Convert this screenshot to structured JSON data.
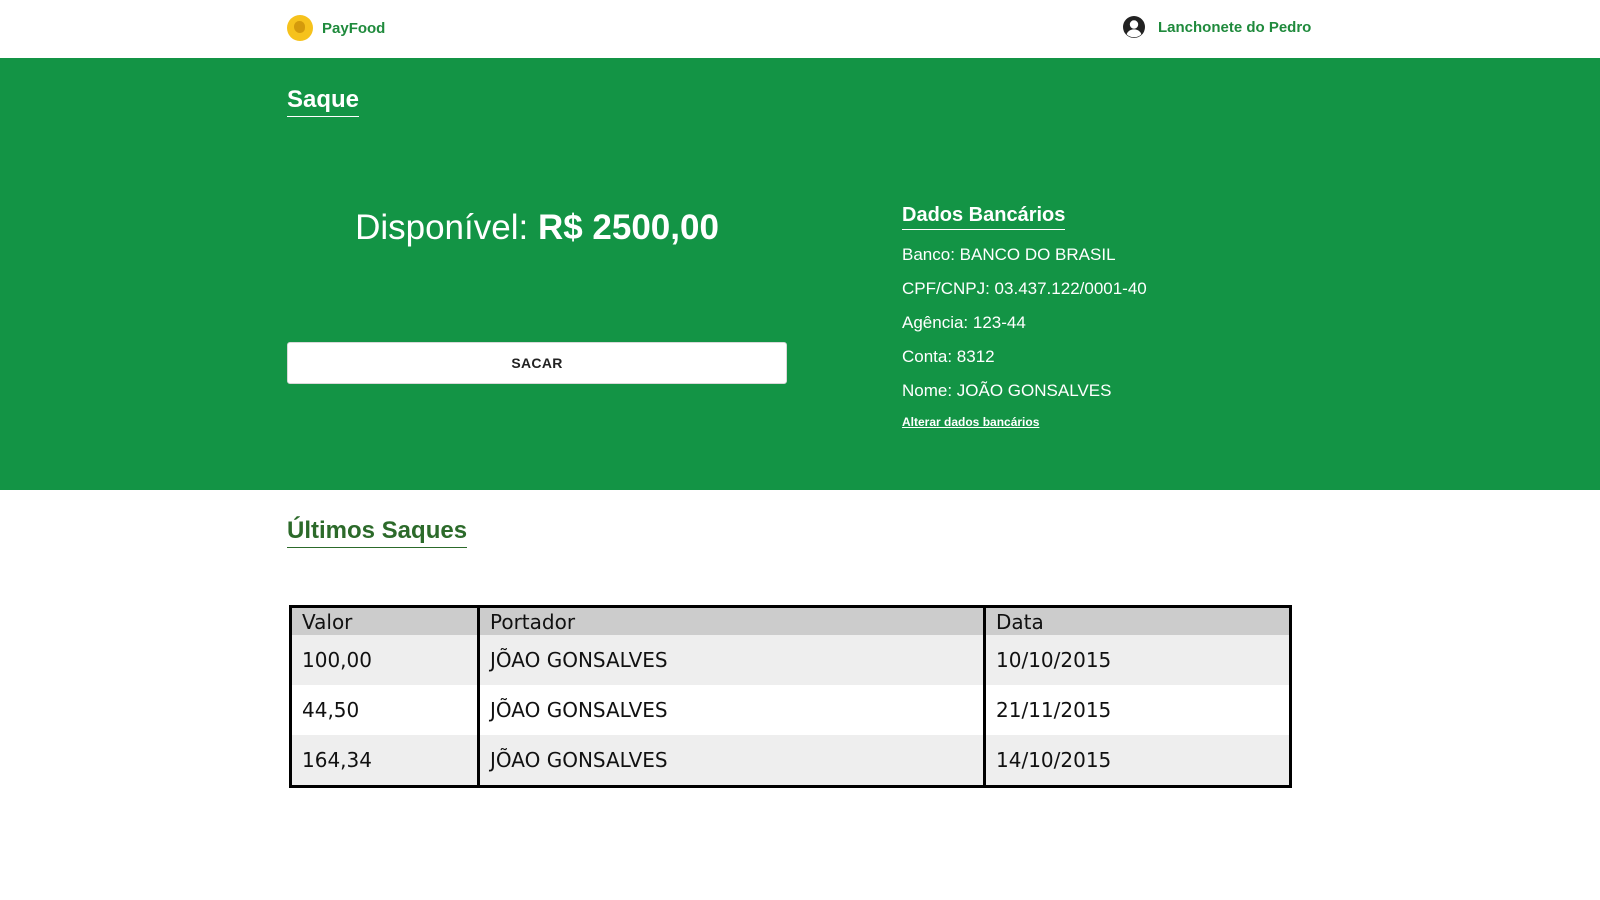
{
  "header": {
    "brand_name": "PayFood",
    "user_name": "Lanchonete do Pedro"
  },
  "hero": {
    "title": "Saque",
    "available_label": "Disponível:",
    "available_amount": "R$ 2500,00",
    "withdraw_button": "SACAR"
  },
  "bank": {
    "title": "Dados Bancários",
    "rows": [
      "Banco: BANCO DO BRASIL",
      "CPF/CNPJ: 03.437.122/0001-40",
      "Agência: 123-44",
      "Conta: 8312",
      "Nome: JOÃO GONSALVES"
    ],
    "change_link": "Alterar dados bancários"
  },
  "history": {
    "title": "Últimos Saques",
    "columns": [
      "Valor",
      "Portador",
      "Data"
    ],
    "rows": [
      [
        "100,00",
        "JÕAO GONSALVES",
        "10/10/2015"
      ],
      [
        "44,50",
        "JÕAO GONSALVES",
        "21/11/2015"
      ],
      [
        "164,34",
        "JÕAO GONSALVES",
        "14/10/2015"
      ]
    ]
  },
  "colors": {
    "brand_green": "#139445",
    "accent_text": "#1f8a3c",
    "heading_green": "#2c6a2a",
    "logo_yellow": "#f6c21c"
  },
  "icons": {
    "brand": "coin-logo-icon",
    "user": "user-avatar-icon"
  }
}
